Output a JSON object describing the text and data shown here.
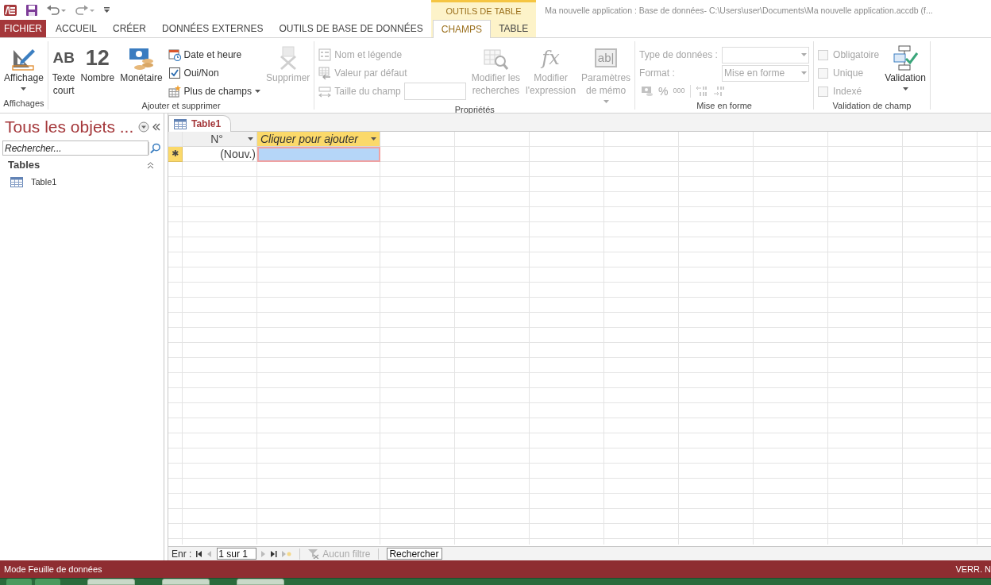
{
  "contextual_header": "OUTILS DE TABLE",
  "window_title": "Ma nouvelle application : Base de données- C:\\Users\\user\\Documents\\Ma nouvelle application.accdb (f...",
  "tabs": [
    {
      "label": "FICHIER",
      "kind": "file",
      "selected": false
    },
    {
      "label": "ACCUEIL",
      "kind": "main",
      "selected": false
    },
    {
      "label": "CRÉER",
      "kind": "main",
      "selected": false
    },
    {
      "label": "DONNÉES EXTERNES",
      "kind": "main",
      "selected": false
    },
    {
      "label": "OUTILS DE BASE DE DONNÉES",
      "kind": "main",
      "selected": false
    },
    {
      "label": "CHAMPS",
      "kind": "contextual",
      "selected": true
    },
    {
      "label": "TABLE",
      "kind": "contextual",
      "selected": false
    }
  ],
  "ribbon_groups": [
    {
      "title": "Affichages",
      "items": [
        {
          "kind": "large",
          "label": "Affichage",
          "dropdown": true,
          "disabled": false
        }
      ]
    },
    {
      "title": "Ajouter et supprimer",
      "items": [
        {
          "kind": "large",
          "glyph": "AB",
          "label": "Texte\ncourt",
          "dropdown": false,
          "disabled": false
        },
        {
          "kind": "large",
          "glyph": "12",
          "label": "Nombre",
          "dropdown": false,
          "disabled": false
        },
        {
          "kind": "large",
          "label": "Monétaire",
          "dropdown": false,
          "disabled": false
        },
        {
          "kind": "column",
          "items": [
            {
              "kind": "small",
              "label": "Date et heure",
              "dropdown": false,
              "disabled": false
            },
            {
              "kind": "small",
              "label": "Oui/Non",
              "dropdown": false,
              "disabled": false
            },
            {
              "kind": "small",
              "label": "Plus de champs",
              "dropdown": true,
              "disabled": false
            }
          ]
        },
        {
          "kind": "large",
          "label": "Supprimer",
          "dropdown": false,
          "disabled": true
        }
      ]
    },
    {
      "title": "Propriétés",
      "items": [
        {
          "kind": "column",
          "items": [
            {
              "kind": "small",
              "label": "Nom et légende",
              "dropdown": false,
              "disabled": true
            },
            {
              "kind": "small",
              "label": "Valeur par défaut",
              "dropdown": false,
              "disabled": true
            },
            {
              "kind": "small_field",
              "label": "Taille du champ",
              "dropdown": false,
              "disabled": true
            }
          ]
        },
        {
          "kind": "large",
          "label": "Modifier les\nrecherches",
          "dropdown": false,
          "disabled": true
        },
        {
          "kind": "large",
          "glyph": "fx",
          "label": "Modifier\nl'expression",
          "dropdown": false,
          "disabled": true
        },
        {
          "kind": "large",
          "glyph": "ab|",
          "label": "Paramètres\nde mémo",
          "dropdown": true,
          "disabled": true
        }
      ]
    },
    {
      "title": "Mise en forme",
      "items": [
        {
          "kind": "column",
          "items": [
            {
              "kind": "combo",
              "label": "Type de données :",
              "disabled": true
            },
            {
              "kind": "combo",
              "label": "Format :",
              "value": "Mise en forme",
              "disabled": true
            },
            {
              "kind": "format_buttons",
              "glyphs": [
                "%",
                "000"
              ],
              "disabled": true
            }
          ]
        }
      ]
    },
    {
      "title": "Validation de champ",
      "items": [
        {
          "kind": "column",
          "items": [
            {
              "kind": "check",
              "label": "Obligatoire",
              "checked": false,
              "disabled": true
            },
            {
              "kind": "check",
              "label": "Unique",
              "checked": false,
              "disabled": true
            },
            {
              "kind": "check",
              "label": "Indexé",
              "checked": false,
              "disabled": true
            }
          ]
        },
        {
          "kind": "large",
          "label": "Validation",
          "dropdown": true,
          "disabled": false
        }
      ]
    }
  ],
  "navigation_pane": {
    "title": "Tous les objets ...",
    "search_placeholder": "Rechercher...",
    "sections": [
      {
        "label": "Tables",
        "expanded": true,
        "items": [
          "Table1"
        ]
      }
    ]
  },
  "document_tabs": [
    {
      "label": "Table1",
      "selected": true
    }
  ],
  "datasheet": {
    "columns": [
      {
        "label": "N°",
        "kind": "field"
      },
      {
        "label": "Cliquer pour ajouter",
        "kind": "add"
      }
    ],
    "rows": [
      {
        "marker": "✱",
        "cells": [
          {
            "value": "(Nouv.)",
            "selected": false
          },
          {
            "selected": true
          }
        ]
      }
    ]
  },
  "record_navigation": {
    "label": "Enr :",
    "position": "1 sur 1",
    "filter": "Aucun filtre",
    "search_placeholder": "Rechercher"
  },
  "status_bar": {
    "left": "Mode Feuille de données",
    "right": "VERR. N"
  }
}
